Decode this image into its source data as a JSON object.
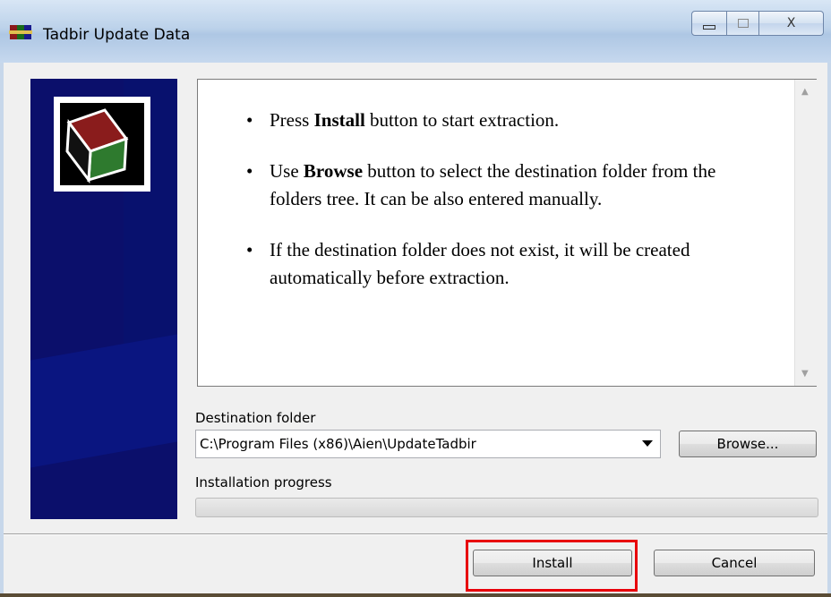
{
  "window": {
    "title": "Tadbir Update Data"
  },
  "titlebar": {
    "minimize_symbol": "▭",
    "maximize_symbol": "□",
    "close_symbol": "X"
  },
  "info": {
    "bullets": [
      {
        "pre": "Press ",
        "bold": "Install",
        "post": " button to start extraction."
      },
      {
        "pre": "Use ",
        "bold": "Browse",
        "post": " button to select the destination folder from the folders tree. It can be also entered manually."
      },
      {
        "pre": "",
        "bold": "",
        "post": "If the destination folder does not exist, it will be created automatically before extraction."
      }
    ]
  },
  "destination": {
    "label": "Destination folder",
    "value": "C:\\Program Files (x86)\\Aien\\UpdateTadbir",
    "browse_label": "Browse..."
  },
  "progress": {
    "label": "Installation progress",
    "value": 0
  },
  "buttons": {
    "install": "Install",
    "cancel": "Cancel"
  },
  "colors": {
    "highlight": "#e8000b",
    "sidebar": "#0b0f6b"
  }
}
